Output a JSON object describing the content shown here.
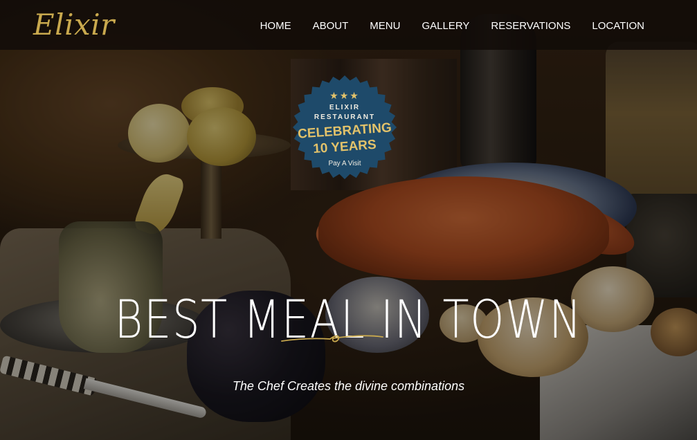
{
  "brand": {
    "logo_text": "Elixir",
    "accent": "#c9a94e"
  },
  "nav": {
    "items": [
      {
        "label": "HOME"
      },
      {
        "label": "ABOUT"
      },
      {
        "label": "MENU"
      },
      {
        "label": "GALLERY"
      },
      {
        "label": "RESERVATIONS"
      },
      {
        "label": "LOCATION"
      }
    ]
  },
  "badge": {
    "stars": "★★★",
    "line1": "ELIXIR",
    "line2": "RESTAURANT",
    "line3": "CELEBRATING",
    "line4": "10 YEARS",
    "line5": "Pay A Visit",
    "bg_color": "#1e4a6a",
    "text_accent": "#e2c26a"
  },
  "hero": {
    "headline": "BEST MEAL IN TOWN",
    "subtitle": "The Chef Creates the divine combinations",
    "divider_icon": "ornament-flourish-icon"
  }
}
